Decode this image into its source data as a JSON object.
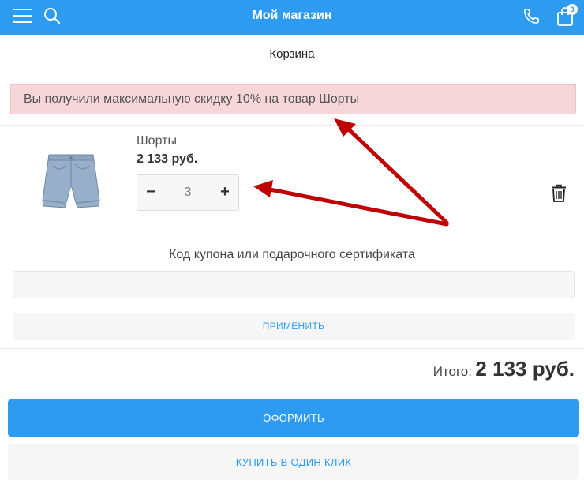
{
  "header": {
    "title": "Мой магазин",
    "cart_count": "3",
    "menu_icon": "hamburger-menu-icon",
    "search_icon": "search-icon",
    "phone_icon": "phone-icon",
    "cart_icon": "shopping-bag-icon",
    "bg_color": "#2d9bf0"
  },
  "page": {
    "title": "Корзина"
  },
  "notice": {
    "text": "Вы получили максимальную скидку 10% на товар Шорты",
    "bg_color": "#f6d6d8"
  },
  "cart": {
    "items": [
      {
        "name": "Шорты",
        "price": "2 133 руб.",
        "quantity": "3",
        "minus_label": "−",
        "plus_label": "+",
        "delete_icon": "trash-icon",
        "image": "denim-shorts-image"
      }
    ]
  },
  "coupon": {
    "label": "Код купона или подарочного сертификата",
    "value": "",
    "placeholder": "",
    "apply_label": "ПРИМЕНИТЬ"
  },
  "summary": {
    "total_label": "Итого:",
    "total_value": "2 133 руб."
  },
  "actions": {
    "checkout_label": "ОФОРМИТЬ",
    "one_click_label": "КУПИТЬ В ОДИН КЛИК",
    "accent_color": "#2d9bf0"
  },
  "annotations": {
    "arrow_color": "#c00000"
  }
}
